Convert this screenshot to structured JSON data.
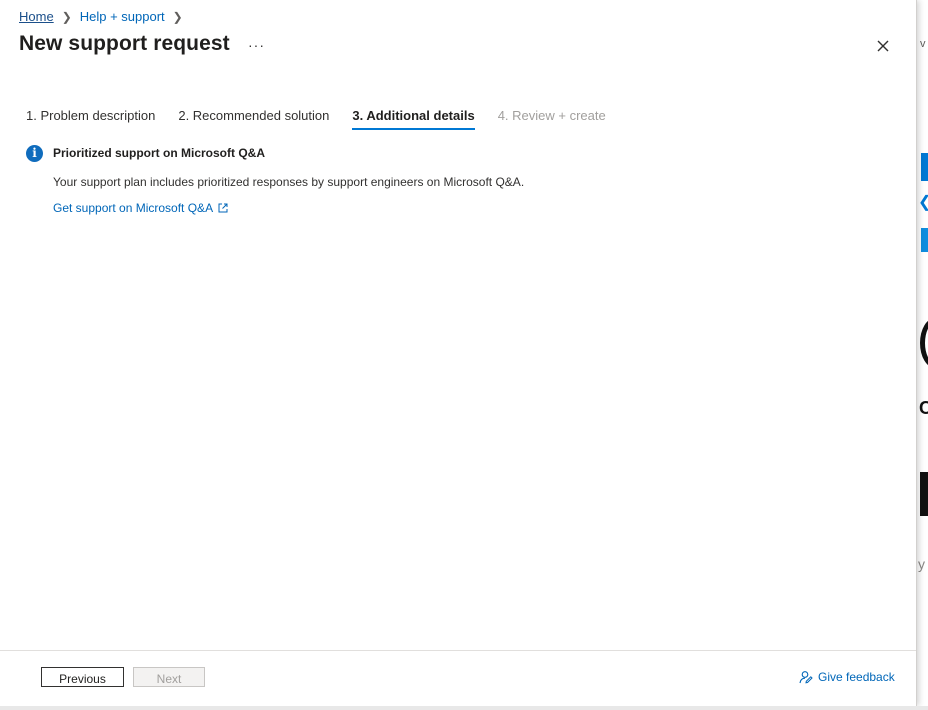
{
  "breadcrumb": {
    "home": "Home",
    "help_support": "Help + support"
  },
  "header": {
    "title": "New support request",
    "more_label": "···"
  },
  "tabs": [
    {
      "label": "1. Problem description",
      "state": "normal"
    },
    {
      "label": "2. Recommended solution",
      "state": "normal"
    },
    {
      "label": "3. Additional details",
      "state": "active"
    },
    {
      "label": "4. Review + create",
      "state": "disabled"
    }
  ],
  "info": {
    "icon": "info-icon",
    "title": "Prioritized support on Microsoft Q&A",
    "description": "Your support plan includes prioritized responses by support engineers on Microsoft Q&A.",
    "link": "Get support on Microsoft Q&A"
  },
  "footer": {
    "previous": "Previous",
    "next": "Next",
    "feedback": "Give feedback"
  },
  "background": {
    "partial_letter_v": "v",
    "partial_letter_c": "C",
    "partial_letter_y": "y"
  },
  "colors": {
    "accent": "#0078d4",
    "link": "#0066b8"
  }
}
